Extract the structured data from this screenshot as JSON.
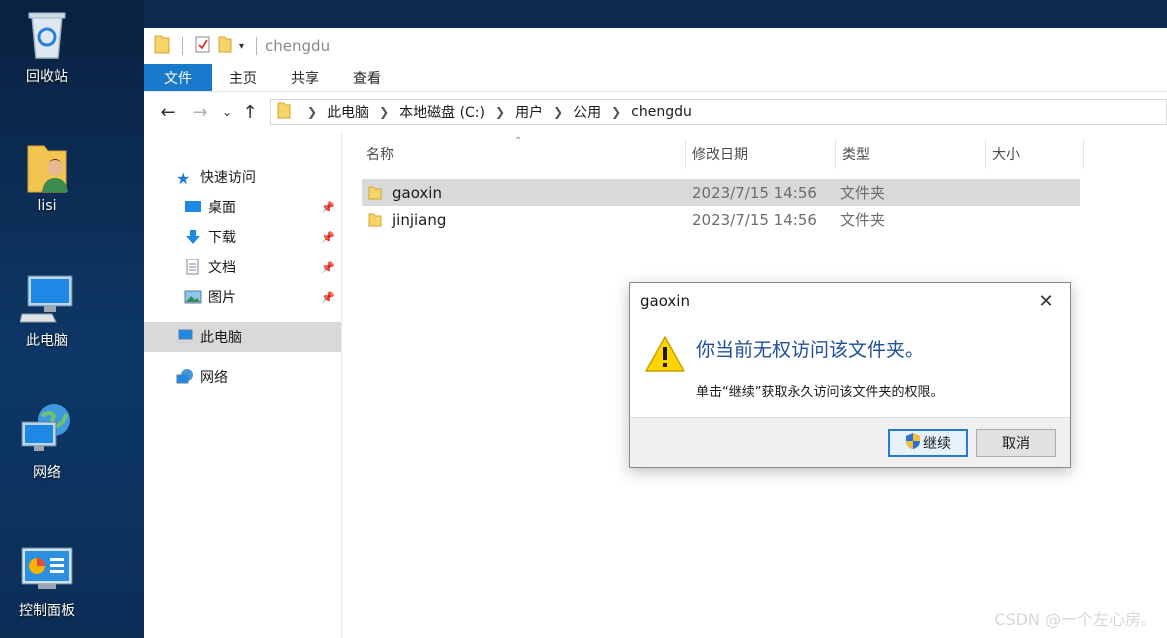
{
  "desktop": {
    "icons": [
      {
        "label": "回收站",
        "icon": "recycle-bin-icon"
      },
      {
        "label": "lisi",
        "icon": "user-folder-icon"
      },
      {
        "label": "此电脑",
        "icon": "computer-icon"
      },
      {
        "label": "网络",
        "icon": "network-icon"
      },
      {
        "label": "控制面板",
        "icon": "control-panel-icon"
      }
    ]
  },
  "window": {
    "title": "chengdu",
    "ribbon_tabs": [
      "文件",
      "主页",
      "共享",
      "查看"
    ],
    "breadcrumb": [
      "此电脑",
      "本地磁盘 (C:)",
      "用户",
      "公用",
      "chengdu"
    ]
  },
  "nav_pane": {
    "quick_access": "快速访问",
    "items": [
      {
        "label": "桌面",
        "icon": "desktop-icon"
      },
      {
        "label": "下载",
        "icon": "download-icon"
      },
      {
        "label": "文档",
        "icon": "document-icon"
      },
      {
        "label": "图片",
        "icon": "pictures-icon"
      }
    ],
    "this_pc": "此电脑",
    "network": "网络"
  },
  "file_list": {
    "columns": [
      "名称",
      "修改日期",
      "类型",
      "大小"
    ],
    "rows": [
      {
        "name": "gaoxin",
        "date": "2023/7/15 14:56",
        "type": "文件夹",
        "selected": true
      },
      {
        "name": "jinjiang",
        "date": "2023/7/15 14:56",
        "type": "文件夹",
        "selected": false
      }
    ]
  },
  "dialog": {
    "title": "gaoxin",
    "message": "你当前无权访问该文件夹。",
    "detail": "单击“继续”获取永久访问该文件夹的权限。",
    "continue_label": "继续",
    "cancel_label": "取消"
  },
  "watermark": "CSDN @一个左心房。",
  "colors": {
    "accent": "#1979ca",
    "dialog_heading": "#1f4e99",
    "selection": "#d9d9d9",
    "desktop_bg": "#0d3766"
  }
}
